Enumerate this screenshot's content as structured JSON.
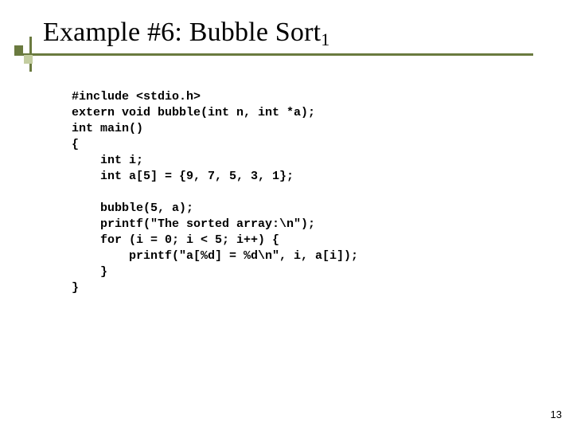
{
  "title": {
    "main": "Example #6: Bubble Sort",
    "subscript": "1"
  },
  "code_lines": [
    "#include <stdio.h>",
    "extern void bubble(int n, int *a);",
    "int main()",
    "{",
    "    int i;",
    "    int a[5] = {9, 7, 5, 3, 1};",
    "",
    "    bubble(5, a);",
    "    printf(\"The sorted array:\\n\");",
    "    for (i = 0; i < 5; i++) {",
    "        printf(\"a[%d] = %d\\n\", i, a[i]);",
    "    }",
    "}"
  ],
  "page_number": "13",
  "colors": {
    "accent_dark": "#6a7a3f",
    "accent_light": "#c3cda0"
  }
}
